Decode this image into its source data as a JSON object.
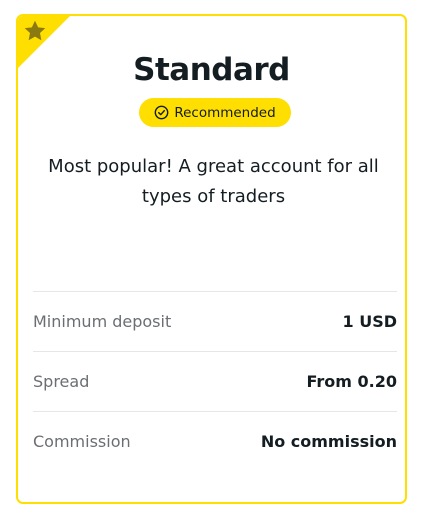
{
  "card": {
    "title": "Standard",
    "badge_label": "Recommended",
    "badge_icon": "check-circle-icon",
    "corner_icon": "star-icon",
    "description": "Most popular! A great account for all types of traders",
    "details": [
      {
        "label": "Minimum deposit",
        "value": "1 USD"
      },
      {
        "label": "Spread",
        "value": "From 0.20"
      },
      {
        "label": "Commission",
        "value": "No commission"
      }
    ]
  },
  "colors": {
    "accent": "#ffde02",
    "text": "#141d22",
    "muted": "#6b6f73",
    "divider": "#e6e6e6"
  }
}
